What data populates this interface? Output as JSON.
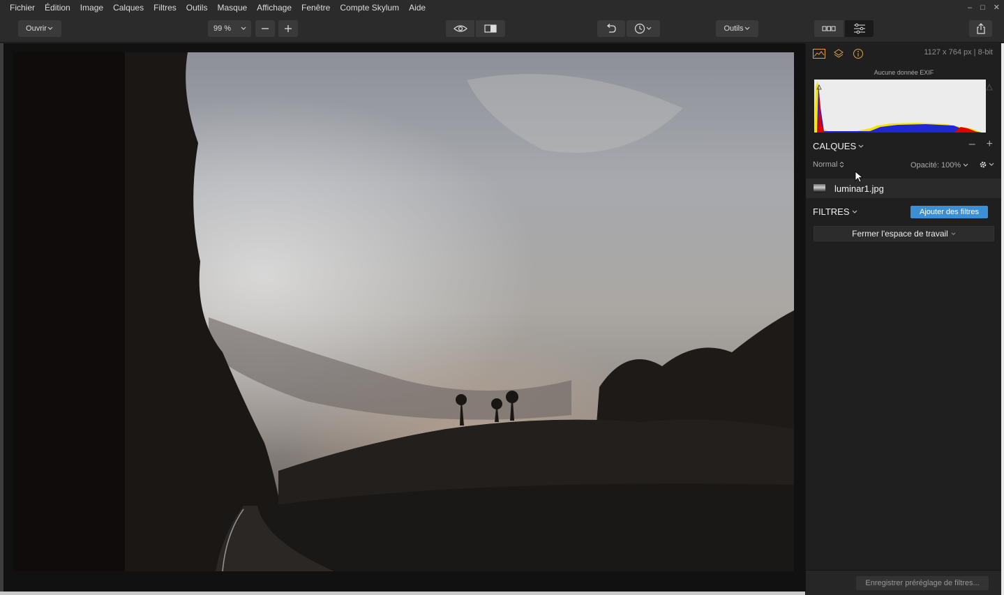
{
  "menu": [
    "Fichier",
    "Édition",
    "Image",
    "Calques",
    "Filtres",
    "Outils",
    "Masque",
    "Affichage",
    "Fenêtre",
    "Compte Skylum",
    "Aide"
  ],
  "window_controls": {
    "minimize": "–",
    "maximize": "□",
    "close": "✕"
  },
  "toolbar": {
    "open_label": "Ouvrir",
    "zoom_value": "99 %",
    "tools_label": "Outils"
  },
  "panel": {
    "dimensions": "1127 x 764 px | 8-bit",
    "exif": "Aucune donnée EXIF",
    "layers_title": "CALQUES",
    "blend_mode": "Normal",
    "opacity": "Opacité: 100%",
    "layer_name": "luminar1.jpg",
    "filters_title": "FILTRES",
    "add_filters": "Ajouter des filtres",
    "close_workspace": "Fermer l'espace de travail",
    "save_preset": "Enregistrer préréglage de filtres..."
  },
  "colors": {
    "accent": "#3b8fd4",
    "histogram_yellow": "#f5e400",
    "histogram_blue": "#1f26d6",
    "histogram_red": "#e00000"
  }
}
